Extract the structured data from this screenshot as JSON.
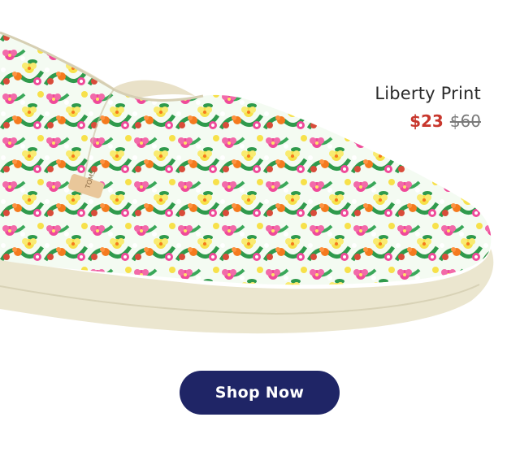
{
  "product": {
    "name": "Liberty Print",
    "sale_price": "$23",
    "original_price": "$60",
    "brand_tag": "TOMS"
  },
  "cta": {
    "label": "Shop Now"
  },
  "colors": {
    "sale": "#c8372d",
    "button": "#1f2566",
    "pattern": [
      "#ef4a9a",
      "#f7e14a",
      "#f57a1e",
      "#2f9a4c",
      "#ffffff"
    ]
  }
}
